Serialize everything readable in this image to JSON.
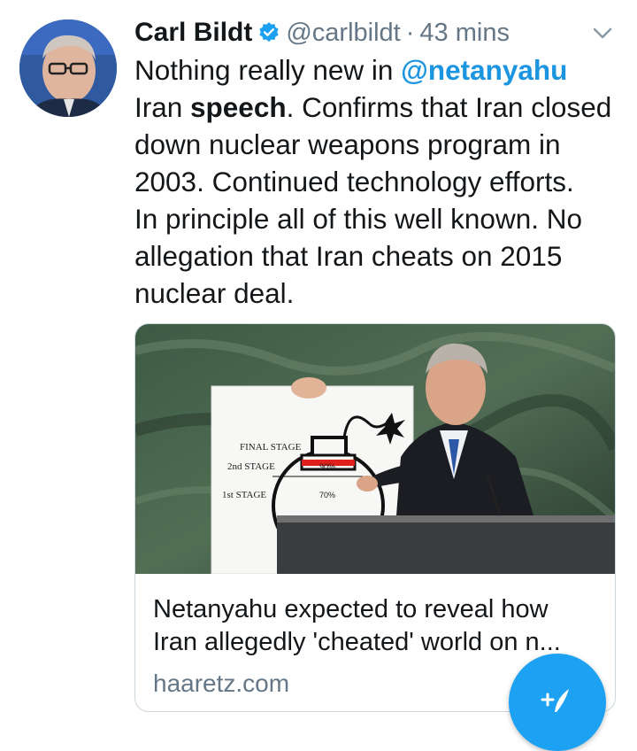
{
  "tweet": {
    "author_name": "Carl Bildt",
    "handle": "@carlbildt",
    "separator": "·",
    "time": "43 mins",
    "verified": true,
    "lines": [
      [
        "Nothing really new in ",
        "@netanyahu",
        ""
      ],
      [
        "Iran ",
        "speech",
        ". Confirms that Iran closed"
      ],
      [
        "down nuclear weapons program in"
      ],
      [
        "2003. Continued technology efforts."
      ],
      [
        "In principle all of this well known. No"
      ],
      [
        "allegation that Iran cheats on 2015"
      ],
      [
        "nuclear deal."
      ]
    ]
  },
  "card": {
    "title_line_1": "Netanyahu expected to reveal how",
    "title_line_2": "Iran allegedly 'cheated' world on n...",
    "domain": "haaretz.com",
    "image": {
      "sign_final_stage": "FINAL STAGE",
      "sign_2nd_stage": "2nd STAGE",
      "sign_1st_stage": "1st STAGE",
      "sign_90": "90%",
      "sign_70": "70%"
    }
  },
  "colors": {
    "accent": "#1da1f2",
    "link": "#1b95e0",
    "muted": "#657786"
  },
  "icons": {
    "verified": "verified-badge-icon",
    "chevron": "chevron-down-icon",
    "compose": "compose-tweet-icon"
  }
}
